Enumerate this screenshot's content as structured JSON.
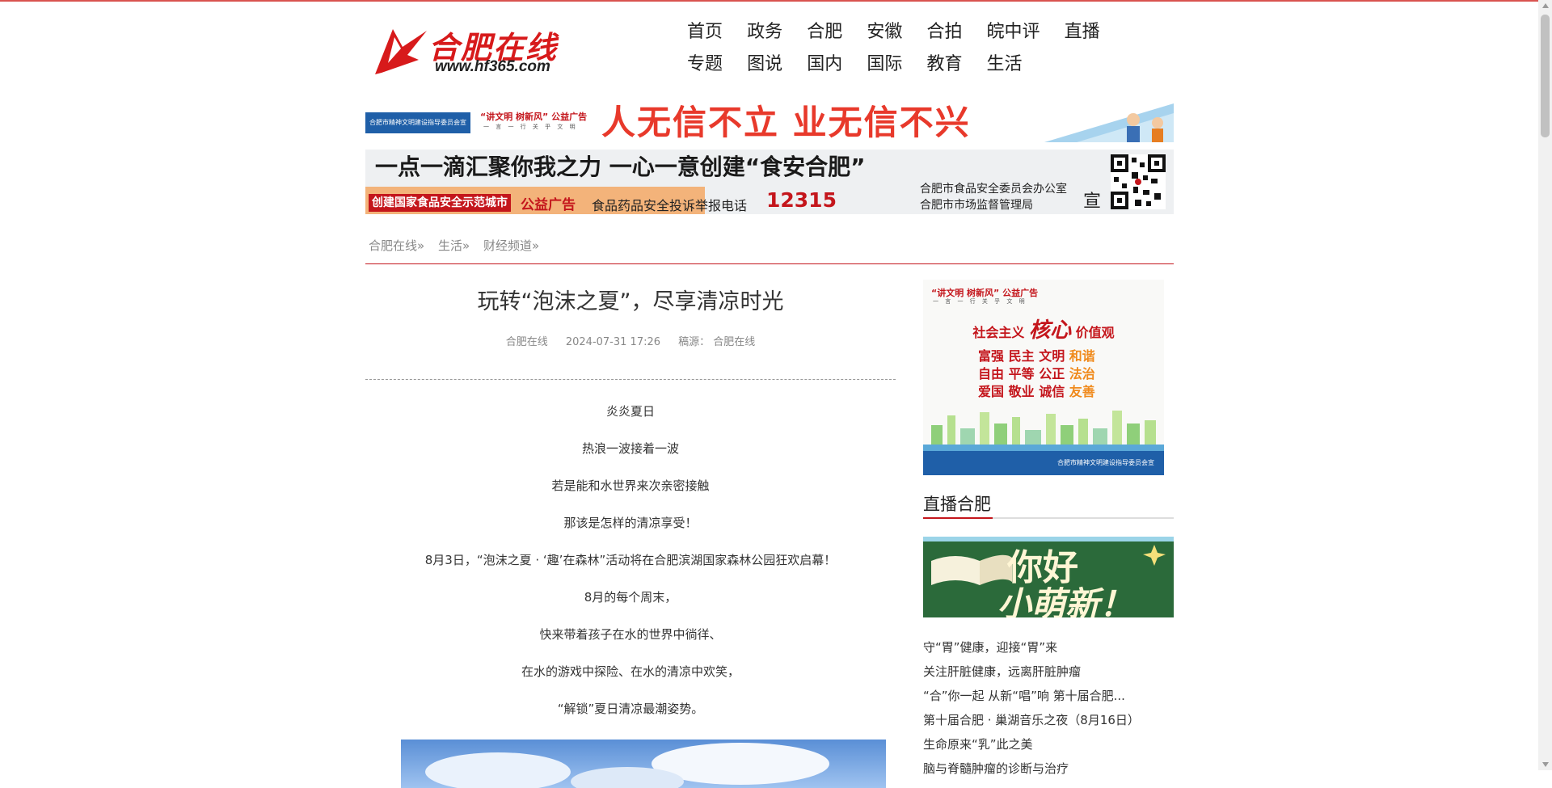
{
  "logo": {
    "name": "合肥在线",
    "url": "www.hf365.com"
  },
  "nav": {
    "row1": [
      "首页",
      "政务",
      "合肥",
      "安徽",
      "合拍",
      "皖中评",
      "直播"
    ],
    "row2": [
      "专题",
      "图说",
      "国内",
      "国际",
      "教育",
      "生活"
    ]
  },
  "banner1": {
    "org": "合肥市精神文明建设指导委员会宣",
    "tag": "“讲文明 树新风” 公益广告",
    "tag_sub": "一 言 一 行  关 乎 文 明",
    "slogan": "人无信不立  业无信不兴"
  },
  "banner2": {
    "slogan": "一点一滴汇聚你我之力  一心一意创建“食安合肥”",
    "label": "创建国家食品安全示范城市",
    "public_ad": "公益广告",
    "hotline_label": "食品药品安全投诉举报电话",
    "hotline": "12315",
    "org1": "合肥市食品安全委员会办公室",
    "org2": "合肥市市场监督管理局",
    "xuan": "宣"
  },
  "breadcrumb": [
    "合肥在线»",
    "生活»",
    "财经频道»"
  ],
  "article": {
    "title": "玩转“泡沫之夏”，尽享清凉时光",
    "source": "合肥在线",
    "date": "2024-07-31 17:26",
    "origin": "稿源： 合肥在线",
    "paragraphs": [
      "炎炎夏日",
      "热浪一波接着一波",
      "若是能和水世界来次亲密接触",
      "那该是怎样的清凉享受！",
      "8月3日，“泡沫之夏 · ‘趣’在森林”活动将在合肥滨湖国家森林公园狂欢启幕！",
      "8月的每个周末，",
      "快来带着孩子在水的世界中徜徉、",
      "在水的游戏中探险、在水的清凉中欢笑，",
      "“解锁”夏日清凉最潮姿势。"
    ]
  },
  "side_ad": {
    "tag": "“讲文明 树新风” 公益广告",
    "tag_sub": "一 言 一 行  关 乎 文 明",
    "pre": "社会主义",
    "big": "核心",
    "post": "价值观",
    "row1": [
      "富强",
      "民主",
      "文明",
      "和谐"
    ],
    "row2": [
      "自由",
      "平等",
      "公正",
      "法治"
    ],
    "row3": [
      "爱国",
      "敬业",
      "诚信",
      "友善"
    ],
    "foot": "合肥市精神文明建设指导委员会宣"
  },
  "live": {
    "title": "直播合肥",
    "image_text1": "你好",
    "image_text2": "小萌新！",
    "items": [
      "守“胃”健康，迎接“胃”来",
      "关注肝脏健康，远离肝脏肿瘤",
      "“合”你一起 从新“唱”响 第十届合肥...",
      "第十届合肥 · 巢湖音乐之夜（8月16日）",
      "生命原来“乳”此之美",
      "脑与脊髓肿瘤的诊断与治疗"
    ]
  },
  "colors": {
    "accent": "#c4161c",
    "top_line": "#d9534f"
  }
}
